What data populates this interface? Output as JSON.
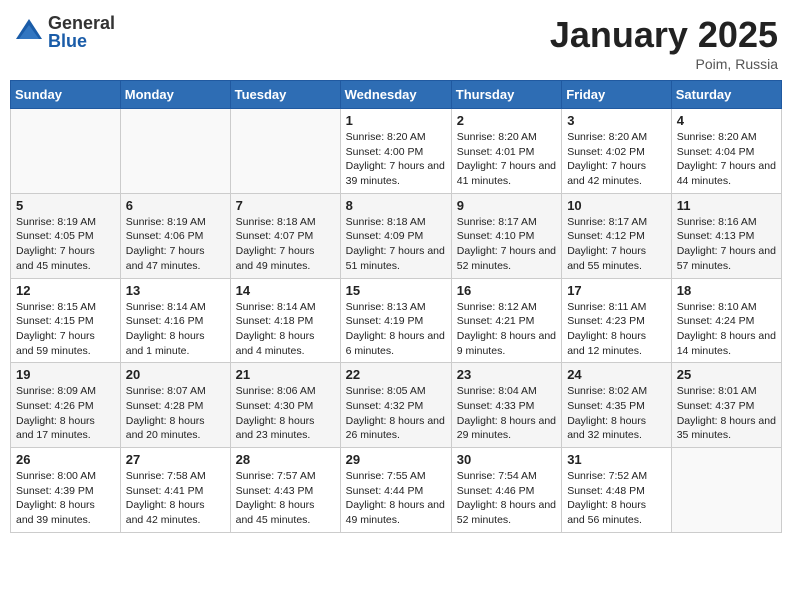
{
  "header": {
    "logo_general": "General",
    "logo_blue": "Blue",
    "month": "January 2025",
    "location": "Poim, Russia"
  },
  "weekdays": [
    "Sunday",
    "Monday",
    "Tuesday",
    "Wednesday",
    "Thursday",
    "Friday",
    "Saturday"
  ],
  "weeks": [
    [
      {
        "day": "",
        "sunrise": "",
        "sunset": "",
        "daylight": ""
      },
      {
        "day": "",
        "sunrise": "",
        "sunset": "",
        "daylight": ""
      },
      {
        "day": "",
        "sunrise": "",
        "sunset": "",
        "daylight": ""
      },
      {
        "day": "1",
        "sunrise": "Sunrise: 8:20 AM",
        "sunset": "Sunset: 4:00 PM",
        "daylight": "Daylight: 7 hours and 39 minutes."
      },
      {
        "day": "2",
        "sunrise": "Sunrise: 8:20 AM",
        "sunset": "Sunset: 4:01 PM",
        "daylight": "Daylight: 7 hours and 41 minutes."
      },
      {
        "day": "3",
        "sunrise": "Sunrise: 8:20 AM",
        "sunset": "Sunset: 4:02 PM",
        "daylight": "Daylight: 7 hours and 42 minutes."
      },
      {
        "day": "4",
        "sunrise": "Sunrise: 8:20 AM",
        "sunset": "Sunset: 4:04 PM",
        "daylight": "Daylight: 7 hours and 44 minutes."
      }
    ],
    [
      {
        "day": "5",
        "sunrise": "Sunrise: 8:19 AM",
        "sunset": "Sunset: 4:05 PM",
        "daylight": "Daylight: 7 hours and 45 minutes."
      },
      {
        "day": "6",
        "sunrise": "Sunrise: 8:19 AM",
        "sunset": "Sunset: 4:06 PM",
        "daylight": "Daylight: 7 hours and 47 minutes."
      },
      {
        "day": "7",
        "sunrise": "Sunrise: 8:18 AM",
        "sunset": "Sunset: 4:07 PM",
        "daylight": "Daylight: 7 hours and 49 minutes."
      },
      {
        "day": "8",
        "sunrise": "Sunrise: 8:18 AM",
        "sunset": "Sunset: 4:09 PM",
        "daylight": "Daylight: 7 hours and 51 minutes."
      },
      {
        "day": "9",
        "sunrise": "Sunrise: 8:17 AM",
        "sunset": "Sunset: 4:10 PM",
        "daylight": "Daylight: 7 hours and 52 minutes."
      },
      {
        "day": "10",
        "sunrise": "Sunrise: 8:17 AM",
        "sunset": "Sunset: 4:12 PM",
        "daylight": "Daylight: 7 hours and 55 minutes."
      },
      {
        "day": "11",
        "sunrise": "Sunrise: 8:16 AM",
        "sunset": "Sunset: 4:13 PM",
        "daylight": "Daylight: 7 hours and 57 minutes."
      }
    ],
    [
      {
        "day": "12",
        "sunrise": "Sunrise: 8:15 AM",
        "sunset": "Sunset: 4:15 PM",
        "daylight": "Daylight: 7 hours and 59 minutes."
      },
      {
        "day": "13",
        "sunrise": "Sunrise: 8:14 AM",
        "sunset": "Sunset: 4:16 PM",
        "daylight": "Daylight: 8 hours and 1 minute."
      },
      {
        "day": "14",
        "sunrise": "Sunrise: 8:14 AM",
        "sunset": "Sunset: 4:18 PM",
        "daylight": "Daylight: 8 hours and 4 minutes."
      },
      {
        "day": "15",
        "sunrise": "Sunrise: 8:13 AM",
        "sunset": "Sunset: 4:19 PM",
        "daylight": "Daylight: 8 hours and 6 minutes."
      },
      {
        "day": "16",
        "sunrise": "Sunrise: 8:12 AM",
        "sunset": "Sunset: 4:21 PM",
        "daylight": "Daylight: 8 hours and 9 minutes."
      },
      {
        "day": "17",
        "sunrise": "Sunrise: 8:11 AM",
        "sunset": "Sunset: 4:23 PM",
        "daylight": "Daylight: 8 hours and 12 minutes."
      },
      {
        "day": "18",
        "sunrise": "Sunrise: 8:10 AM",
        "sunset": "Sunset: 4:24 PM",
        "daylight": "Daylight: 8 hours and 14 minutes."
      }
    ],
    [
      {
        "day": "19",
        "sunrise": "Sunrise: 8:09 AM",
        "sunset": "Sunset: 4:26 PM",
        "daylight": "Daylight: 8 hours and 17 minutes."
      },
      {
        "day": "20",
        "sunrise": "Sunrise: 8:07 AM",
        "sunset": "Sunset: 4:28 PM",
        "daylight": "Daylight: 8 hours and 20 minutes."
      },
      {
        "day": "21",
        "sunrise": "Sunrise: 8:06 AM",
        "sunset": "Sunset: 4:30 PM",
        "daylight": "Daylight: 8 hours and 23 minutes."
      },
      {
        "day": "22",
        "sunrise": "Sunrise: 8:05 AM",
        "sunset": "Sunset: 4:32 PM",
        "daylight": "Daylight: 8 hours and 26 minutes."
      },
      {
        "day": "23",
        "sunrise": "Sunrise: 8:04 AM",
        "sunset": "Sunset: 4:33 PM",
        "daylight": "Daylight: 8 hours and 29 minutes."
      },
      {
        "day": "24",
        "sunrise": "Sunrise: 8:02 AM",
        "sunset": "Sunset: 4:35 PM",
        "daylight": "Daylight: 8 hours and 32 minutes."
      },
      {
        "day": "25",
        "sunrise": "Sunrise: 8:01 AM",
        "sunset": "Sunset: 4:37 PM",
        "daylight": "Daylight: 8 hours and 35 minutes."
      }
    ],
    [
      {
        "day": "26",
        "sunrise": "Sunrise: 8:00 AM",
        "sunset": "Sunset: 4:39 PM",
        "daylight": "Daylight: 8 hours and 39 minutes."
      },
      {
        "day": "27",
        "sunrise": "Sunrise: 7:58 AM",
        "sunset": "Sunset: 4:41 PM",
        "daylight": "Daylight: 8 hours and 42 minutes."
      },
      {
        "day": "28",
        "sunrise": "Sunrise: 7:57 AM",
        "sunset": "Sunset: 4:43 PM",
        "daylight": "Daylight: 8 hours and 45 minutes."
      },
      {
        "day": "29",
        "sunrise": "Sunrise: 7:55 AM",
        "sunset": "Sunset: 4:44 PM",
        "daylight": "Daylight: 8 hours and 49 minutes."
      },
      {
        "day": "30",
        "sunrise": "Sunrise: 7:54 AM",
        "sunset": "Sunset: 4:46 PM",
        "daylight": "Daylight: 8 hours and 52 minutes."
      },
      {
        "day": "31",
        "sunrise": "Sunrise: 7:52 AM",
        "sunset": "Sunset: 4:48 PM",
        "daylight": "Daylight: 8 hours and 56 minutes."
      },
      {
        "day": "",
        "sunrise": "",
        "sunset": "",
        "daylight": ""
      }
    ]
  ]
}
